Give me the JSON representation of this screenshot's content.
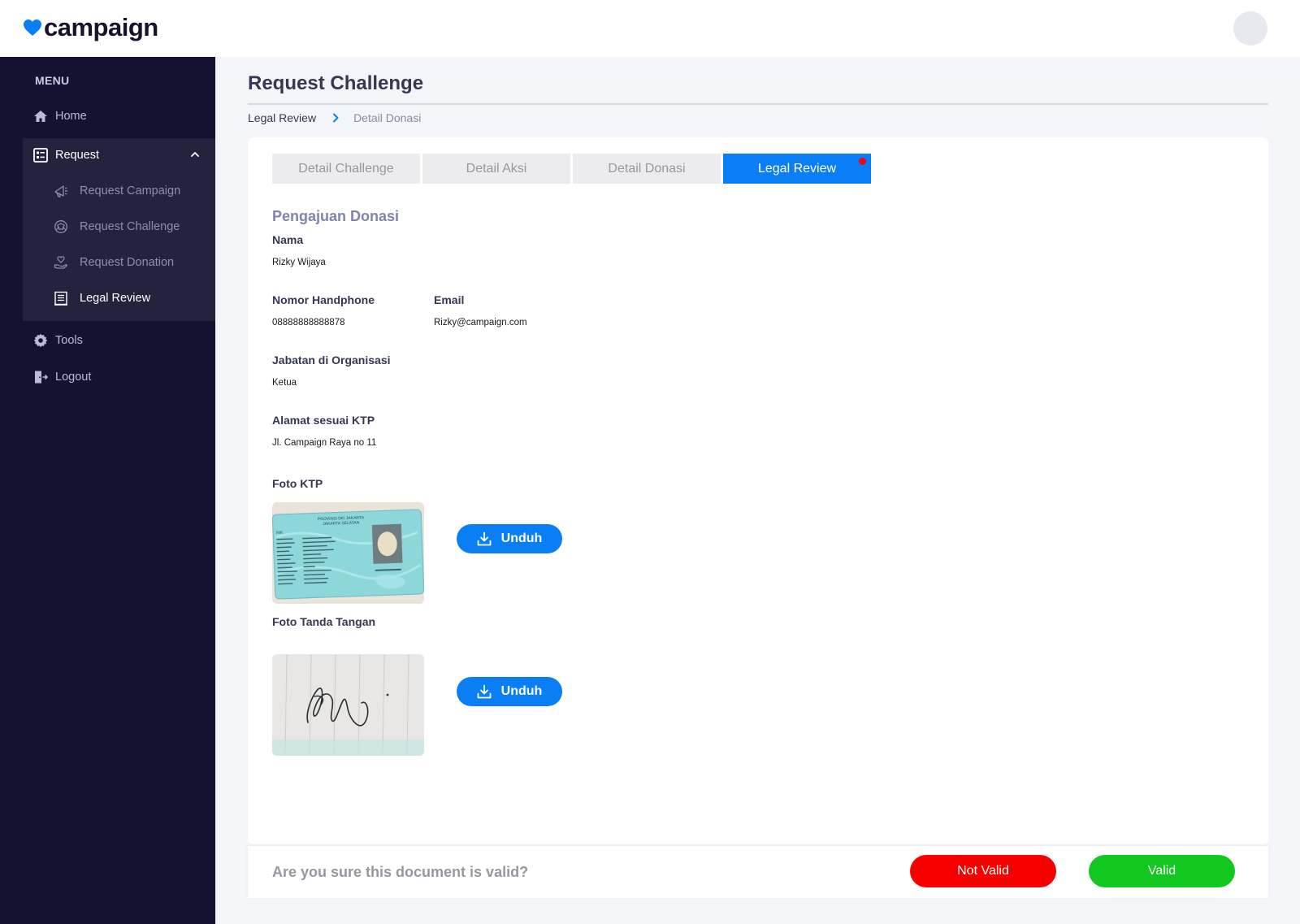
{
  "app": {
    "logo_text": "campaign",
    "brand_color": "#0a7ff5"
  },
  "sidebar": {
    "menu_title": "MENU",
    "items": [
      {
        "label": "Home",
        "icon": "home-icon"
      },
      {
        "label": "Request",
        "icon": "document-list-icon",
        "expanded": true
      },
      {
        "label": "Tools",
        "icon": "gear-icon"
      },
      {
        "label": "Logout",
        "icon": "logout-icon"
      }
    ],
    "request_sub": [
      {
        "label": "Request Campaign",
        "icon": "megaphone-icon"
      },
      {
        "label": "Request Challenge",
        "icon": "badge-icon"
      },
      {
        "label": "Request Donation",
        "icon": "donation-hand-icon"
      },
      {
        "label": "Legal Review",
        "icon": "document-icon",
        "active": true
      }
    ]
  },
  "page": {
    "title": "Request Challenge",
    "breadcrumb": [
      "Legal Review",
      "Detail Donasi"
    ]
  },
  "tabs": [
    {
      "label": "Detail Challenge"
    },
    {
      "label": "Detail Aksi"
    },
    {
      "label": "Detail Donasi"
    },
    {
      "label": "Legal Review",
      "active": true,
      "notification": true
    }
  ],
  "form": {
    "section_title": "Pengajuan Donasi",
    "nama_label": "Nama",
    "nama_value": "Rizky Wijaya",
    "phone_label": "Nomor Handphone",
    "phone_value": "08888888888878",
    "email_label": "Email",
    "email_value": "Rizky@campaign.com",
    "jabatan_label": "Jabatan di Organisasi",
    "jabatan_value": "Ketua",
    "alamat_label": "Alamat sesuai KTP",
    "alamat_value": "Jl. Campaign Raya no 11",
    "ktp_label": "Foto KTP",
    "signature_label": "Foto Tanda Tangan",
    "download_label": "Unduh"
  },
  "ktp_card": {
    "header_line1": "PROVINSI DKI JAKARTA",
    "header_line2": "JAKARTA SELATAN",
    "nik_label": "NIK"
  },
  "confirm": {
    "question": "Are you sure this document is valid?",
    "not_valid_label": "Not Valid",
    "not_valid_color": "#f70000",
    "valid_label": "Valid",
    "valid_color": "#12c71f"
  }
}
